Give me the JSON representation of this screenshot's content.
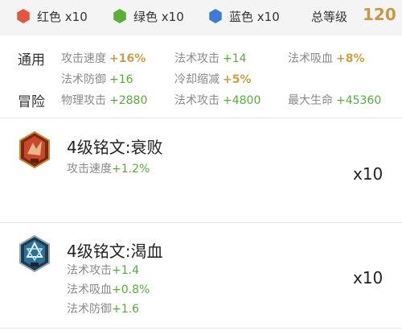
{
  "header": {
    "gems": [
      {
        "label": "红色 x10",
        "color": "#e2573f",
        "icon": "red-hex-icon"
      },
      {
        "label": "绿色 x10",
        "color": "#5cae3b",
        "icon": "green-hex-icon"
      },
      {
        "label": "蓝色 x10",
        "color": "#3f7ad6",
        "icon": "blue-hex-icon"
      }
    ],
    "level_label": "总等级",
    "level_value": "120"
  },
  "stats": {
    "general_label": "通用",
    "adventure_label": "冒险",
    "general": [
      {
        "name": "攻击速度",
        "value": "+16%"
      },
      {
        "name": "法术攻击",
        "value": "+14"
      },
      {
        "name": "法术吸血",
        "value": "+8%"
      },
      {
        "name": "法术防御",
        "value": "+16"
      },
      {
        "name": "冷却缩减",
        "value": "+5%"
      }
    ],
    "adventure": [
      {
        "name": "物理攻击",
        "value": "+2880"
      },
      {
        "name": "法术攻击",
        "value": "+4800"
      },
      {
        "name": "最大生命",
        "value": "+45360"
      }
    ]
  },
  "inscriptions": [
    {
      "title": "4级铭文:衰败",
      "icon": "red-inscription-icon",
      "attrs": [
        {
          "name": "攻击速度",
          "value": "+1.2%"
        }
      ],
      "count": "x10"
    },
    {
      "title": "4级铭文:渴血",
      "icon": "blue-inscription-icon",
      "attrs": [
        {
          "name": "法术攻击",
          "value": "+1.4"
        },
        {
          "name": "法术吸血",
          "value": "+0.8%"
        },
        {
          "name": "法术防御",
          "value": "+1.6"
        }
      ],
      "count": "x10"
    }
  ],
  "colors": {
    "gold": "#c9a14a",
    "green": "#5aaa3e",
    "grey_text": "#8a8a8a"
  }
}
